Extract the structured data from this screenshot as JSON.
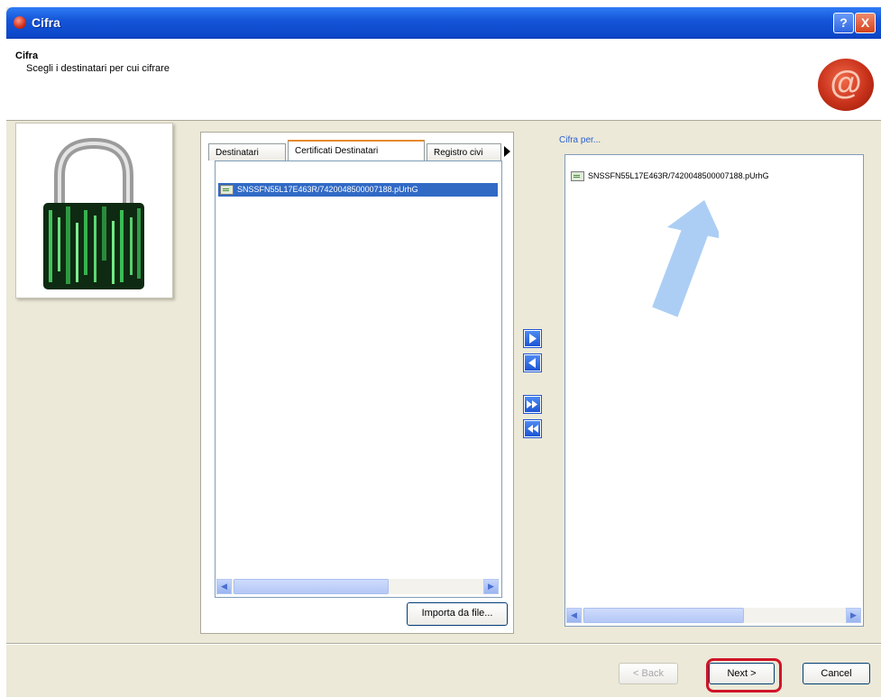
{
  "window": {
    "title": "Cifra",
    "help_label": "?",
    "close_label": "X"
  },
  "header": {
    "title": "Cifra",
    "subtitle": "Scegli i destinatari per cui cifrare",
    "seal_symbol": "@"
  },
  "left_panel": {
    "tabs": [
      "Destinatari",
      "Certificati Destinatari",
      "Registro civi"
    ],
    "active_tab": "Certificati Destinatari",
    "list_items": [
      "SNSSFN55L17E463R/7420048500007188.pUrhG"
    ],
    "import_button": "Importa da file..."
  },
  "move_buttons": [
    "add-selected",
    "remove-selected",
    "add-all",
    "remove-all"
  ],
  "right_panel": {
    "label": "Cifra per...",
    "list_items": [
      "SNSSFN55L17E463R/7420048500007188.pUrhG"
    ]
  },
  "footer": {
    "back": "< Back",
    "next": "Next >",
    "cancel": "Cancel"
  },
  "colors": {
    "titlebar": "#0c47c9",
    "selection": "#316ac5",
    "highlight_ring": "#d01428",
    "arrow": "#9ec5f2"
  }
}
